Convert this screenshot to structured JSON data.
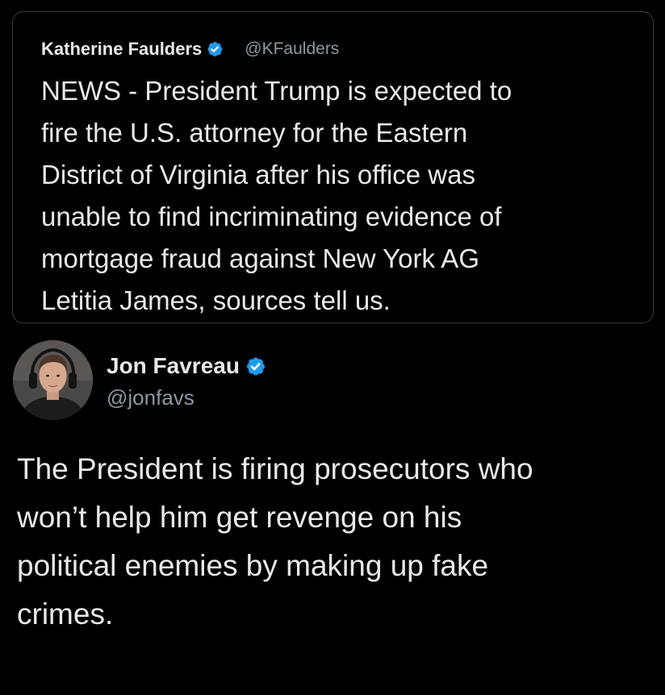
{
  "quoted_tweet": {
    "author_name": "Katherine Faulders",
    "verified_icon": "verified-badge-icon",
    "handle": "@KFaulders",
    "text": "NEWS - President Trump is expected to\nfire the U.S. attorney for the Eastern\nDistrict of Virginia after his office was\nunable to find incriminating evidence of\nmortgage fraud against New York AG\nLetitia James, sources tell us."
  },
  "tweet": {
    "author_name": "Jon Favreau",
    "verified_icon": "verified-badge-icon",
    "handle": "@jonfavs",
    "text": "The President is firing prosecutors who\nwon’t help him get revenge on his\npolitical enemies by making up fake\ncrimes."
  },
  "colors": {
    "background": "#000000",
    "text_primary": "#e7e9ea",
    "text_secondary": "#8b98a5",
    "verified_blue": "#1d9bf0",
    "card_border": "#3a3d40"
  }
}
